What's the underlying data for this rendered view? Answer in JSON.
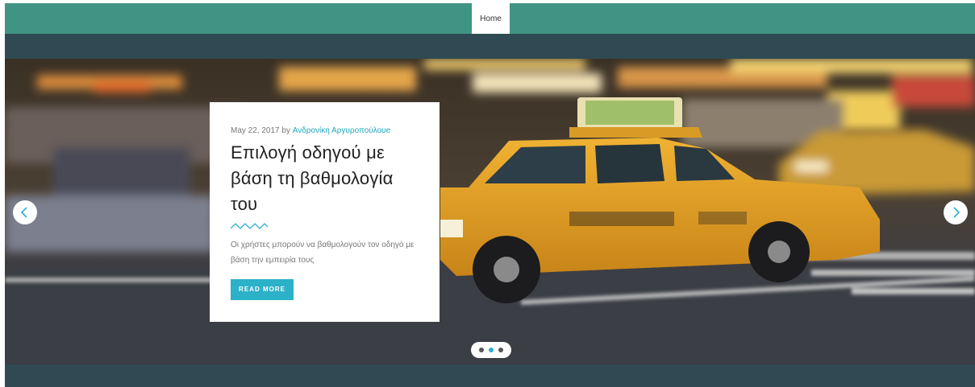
{
  "nav": {
    "home_label": "Home"
  },
  "slide": {
    "date": "May 22, 2017",
    "by": "by",
    "author": "Ανδρονίκη Αργυροπούλουe",
    "title": "Επιλογή οδηγού με βάση τη βαθμολογία του",
    "excerpt": "Οι χρήστες μπορούν να βαθμολογούν τον οδηγό με βάση την εμπειρία τους",
    "read_more": "READ MORE"
  },
  "slider": {
    "active_index": 1,
    "dot_count": 3
  },
  "colors": {
    "nav_bg": "#3f9483",
    "band_bg": "#2f4a52",
    "accent": "#2bb1c8",
    "card_bg": "#ffffff"
  },
  "icons": {
    "prev": "chevron-left-icon",
    "next": "chevron-right-icon",
    "divider": "wave-divider-icon"
  }
}
